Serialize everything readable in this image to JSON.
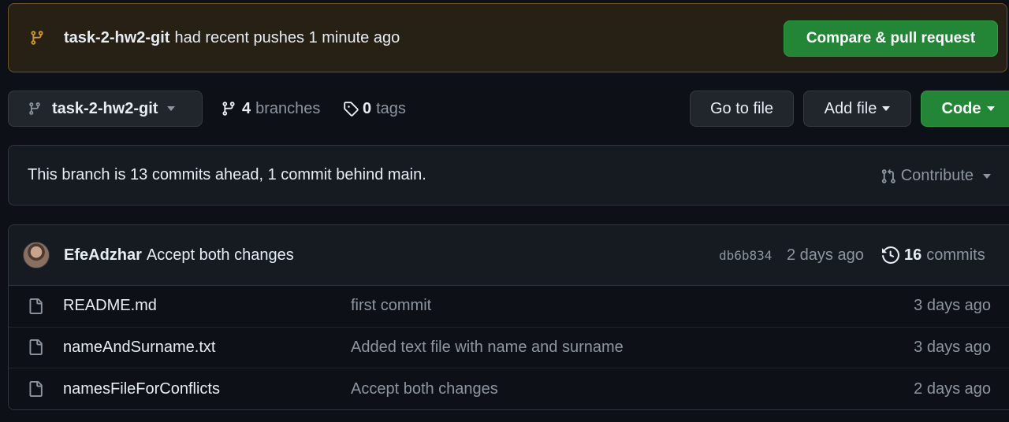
{
  "banner": {
    "branch": "task-2-hw2-git",
    "message": "had recent pushes 1 minute ago",
    "button": "Compare & pull request"
  },
  "toolbar": {
    "branch_select": "task-2-hw2-git",
    "branches_count": "4",
    "branches_label": "branches",
    "tags_count": "0",
    "tags_label": "tags",
    "go_to_file": "Go to file",
    "add_file": "Add file",
    "code": "Code"
  },
  "status": {
    "ahead_behind": "This branch is 13 commits ahead, 1 commit behind main.",
    "contribute": "Contribute"
  },
  "latest_commit": {
    "author": "EfeAdzhar",
    "message": "Accept both changes",
    "sha": "db6b834",
    "date": "2 days ago",
    "commits_count": "16",
    "commits_label": "commits"
  },
  "files": [
    {
      "name": "README.md",
      "message": "first commit",
      "date": "3 days ago"
    },
    {
      "name": "nameAndSurname.txt",
      "message": "Added text file with name and surname",
      "date": "3 days ago"
    },
    {
      "name": "namesFileForConflicts",
      "message": "Accept both changes",
      "date": "2 days ago"
    }
  ],
  "colors": {
    "background": "#0d1117",
    "banner_bg": "#272115",
    "banner_border": "#6b5420",
    "branch_icon": "#d29922",
    "primary_button": "#238636",
    "muted_text": "#8d96a0"
  }
}
